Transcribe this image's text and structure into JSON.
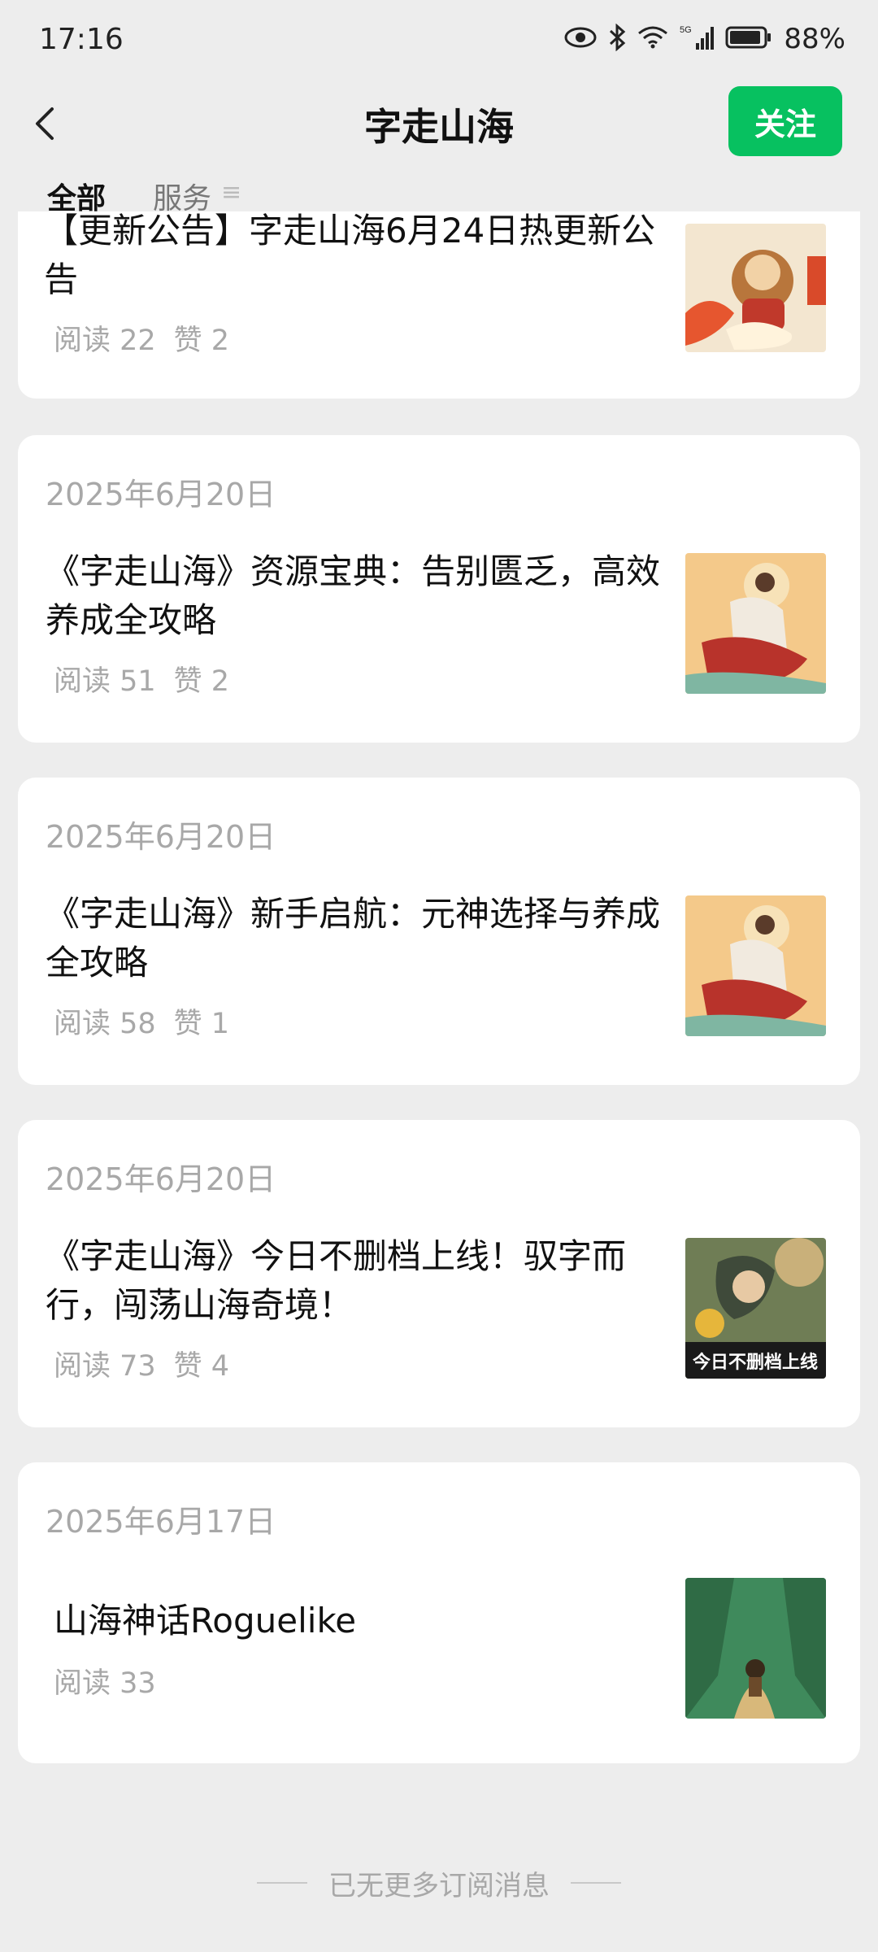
{
  "status_bar": {
    "time": "17:16",
    "network": "5G",
    "battery": "88%"
  },
  "header": {
    "title": "字走山海",
    "follow_label": "关注"
  },
  "tabs": [
    {
      "label": "全部"
    },
    {
      "label": "服务"
    },
    {
      "label": "≡"
    }
  ],
  "articles": [
    {
      "date": "",
      "title": "【更新公告】字走山海6月24日热更新公告",
      "reads": "阅读 22",
      "likes": "赞 2",
      "thumb": "monkey-king-art"
    },
    {
      "date": "2025年6月20日",
      "title": "《字走山海》资源宝典：告别匮乏，高效养成全攻略",
      "reads": "阅读 51",
      "likes": "赞 2",
      "thumb": "deity-art"
    },
    {
      "date": "2025年6月20日",
      "title": "《字走山海》新手启航：元神选择与养成全攻略",
      "reads": "阅读 58",
      "likes": "赞 1",
      "thumb": "deity-art"
    },
    {
      "date": "2025年6月20日",
      "title": "《字走山海》今日不删档上线！驭字而行，闯荡山海奇境！",
      "reads": "阅读 73",
      "likes": "赞 4",
      "thumb": "launch-art",
      "thumb_caption": "今日不删档上线"
    },
    {
      "date": "2025年6月17日",
      "title": "山海神话Roguelike",
      "reads": "阅读 33",
      "likes": "",
      "thumb": "forest-art"
    }
  ],
  "footer": {
    "text": "已无更多订阅消息"
  },
  "colors": {
    "accent": "#07c160",
    "background": "#ededed",
    "muted_text": "#a8a8a8"
  }
}
